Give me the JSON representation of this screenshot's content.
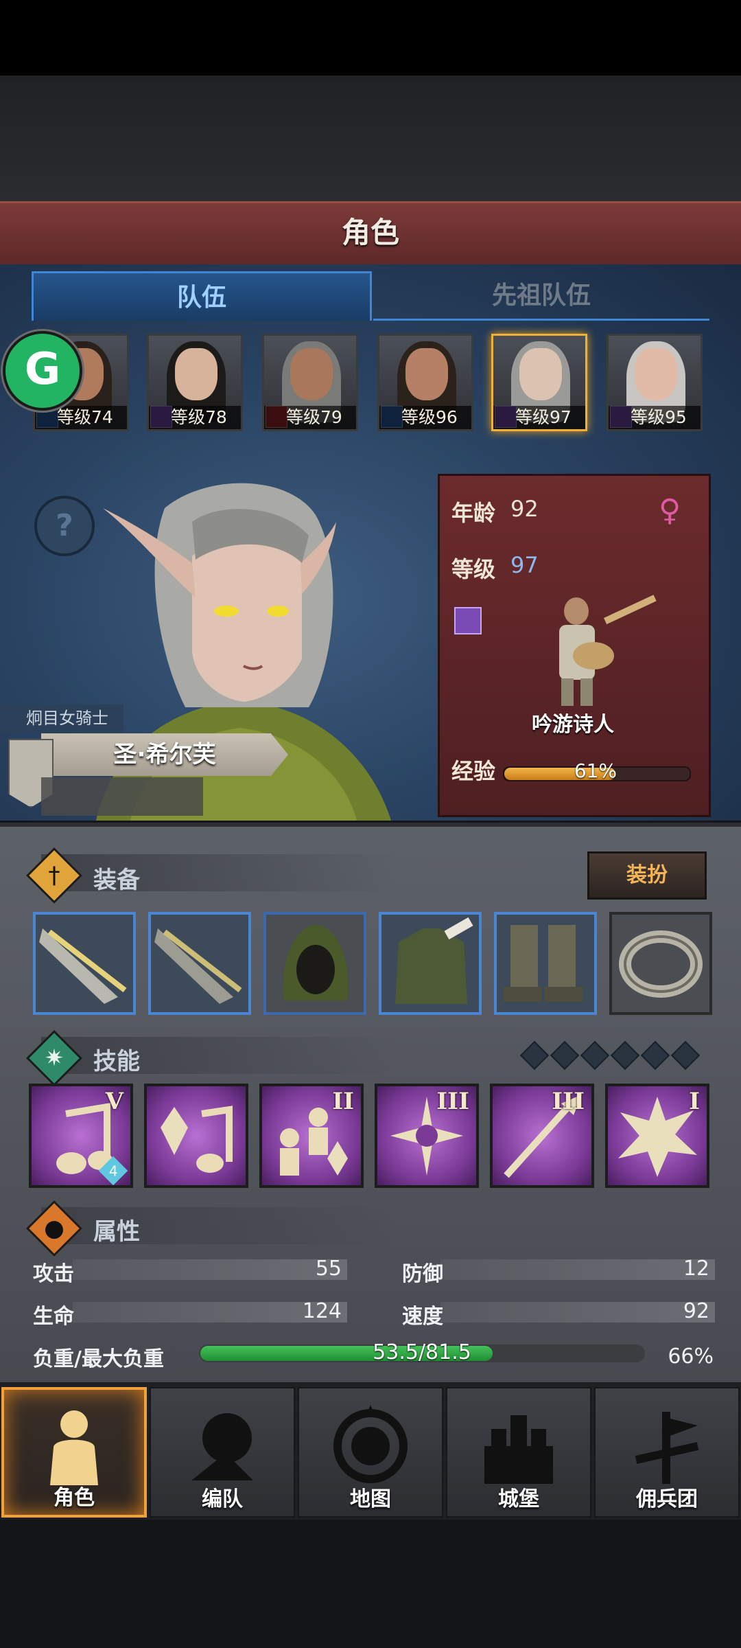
{
  "header": {
    "title": "角色"
  },
  "tabs": [
    {
      "label": "队伍",
      "active": true
    },
    {
      "label": "先祖队伍",
      "active": false
    }
  ],
  "roster": [
    {
      "level": "等级74",
      "class_icon": "sword-icon",
      "selected": false
    },
    {
      "level": "等级78",
      "class_icon": "staff-icon",
      "selected": false
    },
    {
      "level": "等级79",
      "class_icon": "horse-icon",
      "selected": false
    },
    {
      "level": "等级96",
      "class_icon": "sword-icon",
      "selected": false
    },
    {
      "level": "等级97",
      "class_icon": "staff-icon",
      "selected": true
    },
    {
      "level": "等级95",
      "class_icon": "staff-icon",
      "selected": false
    }
  ],
  "character": {
    "title": "炯目女骑士",
    "name": "圣·希尔芙",
    "age_label": "年龄",
    "age": "92",
    "level_label": "等级",
    "level": "97",
    "gender_icon": "female-icon",
    "class_name": "吟游诗人",
    "exp_label": "经验",
    "exp_percent": "61%",
    "exp_fraction": 0.61
  },
  "equipment": {
    "title": "装备",
    "dress_button": "装扮",
    "slots": [
      "weapon-main",
      "weapon-offhand",
      "hood",
      "armor",
      "boots",
      "ring"
    ]
  },
  "skills": {
    "title": "技能",
    "pips": 6,
    "items": [
      {
        "icon": "song-icon",
        "rank": "V",
        "badge": "4"
      },
      {
        "icon": "crystal-song-icon",
        "rank": "",
        "badge": ""
      },
      {
        "icon": "crowd-crystal-icon",
        "rank": "II",
        "badge": ""
      },
      {
        "icon": "holy-cross-icon",
        "rank": "III",
        "badge": ""
      },
      {
        "icon": "spear-icon",
        "rank": "III",
        "badge": ""
      },
      {
        "icon": "burst-icon",
        "rank": "I",
        "badge": ""
      }
    ]
  },
  "attributes": {
    "title": "属性",
    "attack_label": "攻击",
    "attack": "55",
    "defense_label": "防御",
    "defense": "12",
    "hp_label": "生命",
    "hp": "124",
    "speed_label": "速度",
    "speed": "92",
    "load_label": "负重/最大负重",
    "load": "53.5/81.5",
    "load_percent": "66%",
    "load_fraction": 0.66
  },
  "nav": [
    {
      "label": "角色",
      "icon": "knight-icon",
      "active": true
    },
    {
      "label": "编队",
      "icon": "formation-icon",
      "active": false
    },
    {
      "label": "地图",
      "icon": "compass-map-icon",
      "active": false
    },
    {
      "label": "城堡",
      "icon": "castle-icon",
      "active": false
    },
    {
      "label": "佣兵团",
      "icon": "mercenary-banner-icon",
      "active": false
    }
  ],
  "overlay": {
    "badge_letter": "G"
  },
  "colors": {
    "accent_blue": "#3f87d6",
    "header_red": "#6d3131",
    "gold": "#f0b233",
    "exp_orange": "#e39a2c",
    "load_green": "#2fa845"
  }
}
